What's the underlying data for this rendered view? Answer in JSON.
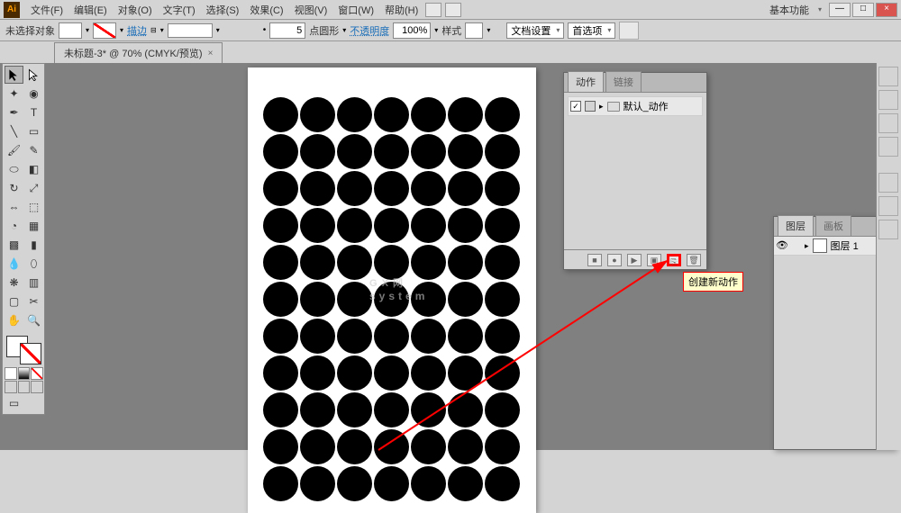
{
  "menu": {
    "file": "文件(F)",
    "edit": "编辑(E)",
    "object": "对象(O)",
    "type": "文字(T)",
    "select": "选择(S)",
    "effect": "效果(C)",
    "view": "视图(V)",
    "window": "窗口(W)",
    "help": "帮助(H)"
  },
  "workspace": "基本功能",
  "ctrl": {
    "no_sel": "未选择对象",
    "stroke": "描边",
    "stroke_val": "5",
    "stroke_style": "点圆形",
    "opacity": "不透明度",
    "opacity_val": "100%",
    "style": "样式",
    "docset": "文档设置",
    "prefs": "首选项"
  },
  "doc": {
    "tab": "未标题-3* @ 70% (CMYK/预览)"
  },
  "actions_panel": {
    "tab_actions": "动作",
    "tab_links": "链接",
    "default_set": "默认_动作",
    "tooltip": "创建新动作"
  },
  "layers_panel": {
    "tab_layers": "图层",
    "tab_artboards": "画板",
    "layer_name": "图层 1"
  },
  "watermark": {
    "big": "G X 网",
    "small": "system"
  },
  "grid": {
    "rows": 11,
    "cols": 7
  }
}
